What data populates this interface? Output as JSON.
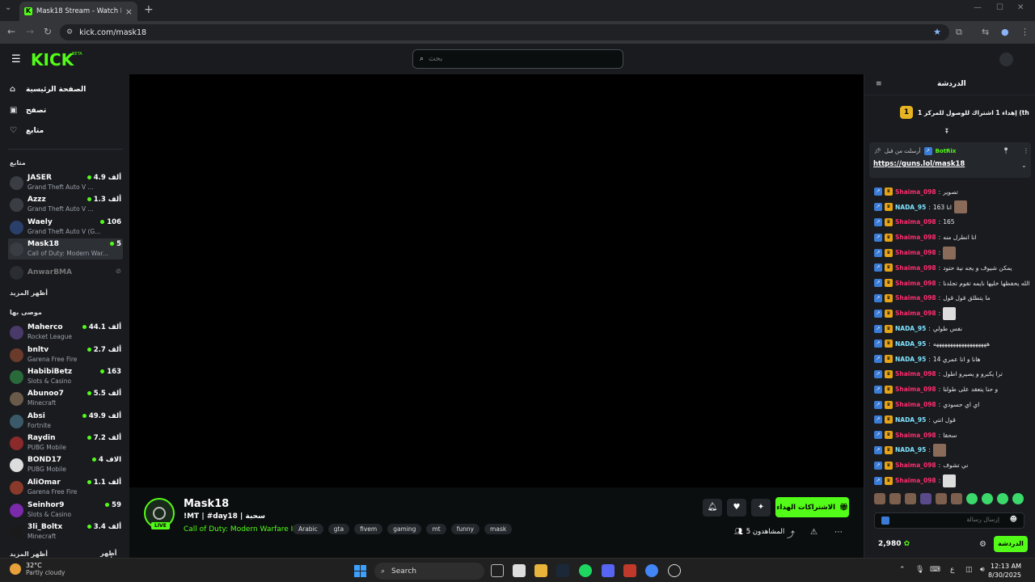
{
  "browser": {
    "tab_title": "Mask18 Stream - Watch Live on",
    "url": "kick.com/mask18"
  },
  "header": {
    "logo": "KICK",
    "logo_badge": "BETA",
    "search_placeholder": "بحث"
  },
  "sidebar": {
    "nav": [
      {
        "label": "الصفحة الرئيسية",
        "icon": "home-icon"
      },
      {
        "label": "تصفح",
        "icon": "browse-icon"
      },
      {
        "label": "متابع",
        "icon": "heart-icon"
      }
    ],
    "following_title": "متابع",
    "following": [
      {
        "name": "JASER",
        "game": "Grand Theft Auto V ...",
        "viewers": "4.9 ألف"
      },
      {
        "name": "Azzz",
        "game": "Grand Theft Auto V ...",
        "viewers": "1.3 ألف"
      },
      {
        "name": "Waely",
        "game": "Grand Theft Auto V (G...",
        "viewers": "106"
      },
      {
        "name": "Mask18",
        "game": "Call of Duty: Modern War...",
        "viewers": "5"
      },
      {
        "name": "AnwarBMA",
        "game": "",
        "viewers": ""
      }
    ],
    "show_more": "أظهر المزيد",
    "recommended_title": "موصى بها",
    "recommended": [
      {
        "name": "Maherco",
        "game": "Rocket League",
        "viewers": "44.1 ألف"
      },
      {
        "name": "bnltv",
        "game": "Garena Free Fire",
        "viewers": "2.7 ألف"
      },
      {
        "name": "HabibiBetz",
        "game": "Slots & Casino",
        "viewers": "163"
      },
      {
        "name": "Abunoo7",
        "game": "Minecraft",
        "viewers": "5.5 ألف"
      },
      {
        "name": "Absi",
        "game": "Fortnite",
        "viewers": "49.9 ألف"
      },
      {
        "name": "Raydin",
        "game": "PUBG Mobile",
        "viewers": "7.2 ألف"
      },
      {
        "name": "BOND17",
        "game": "PUBG Mobile",
        "viewers": "4 الاف"
      },
      {
        "name": "AliOmar",
        "game": "Garena Free Fire",
        "viewers": "1.1 ألف"
      },
      {
        "name": "Seinhor9",
        "game": "Slots & Casino",
        "viewers": "59"
      },
      {
        "name": "3li_Boltx",
        "game": "Minecraft",
        "viewers": "3.4 ألف"
      }
    ],
    "show_more_2": "أظهر المزيد",
    "show_less": "أظهر أقل"
  },
  "stream": {
    "name": "Mask18",
    "title": "!MT | #day18 | سحبة",
    "game": "Call of Duty: Modern Warfare III",
    "live_badge": "LIVE",
    "tags": [
      "Arabic",
      "gta",
      "fivem",
      "gaming",
      "mt",
      "funny",
      "mask"
    ],
    "subscribe_label": "الاشتراكات الهداء",
    "viewers_label": "5 المشاهدون"
  },
  "chat": {
    "title": "الدردشة",
    "goal": "إهداء 1 اشتراك للوصول للمركز 1 (th",
    "goal_rank": "1",
    "pinned_by_label": "أرسلت من قبل",
    "pinned_by": "BotRix",
    "pinned_link": "https://guns.lol/mask18",
    "messages": [
      {
        "user": "Shaima_098",
        "color": "pink",
        "text": "تصوير",
        "emote": ""
      },
      {
        "user": "NADA_95",
        "color": "teal",
        "text": "انا 163",
        "emote": "img"
      },
      {
        "user": "Shaima_098",
        "color": "pink",
        "text": "165",
        "emote": ""
      },
      {
        "user": "Shaima_098",
        "color": "pink",
        "text": "انا انطرل منه",
        "emote": ""
      },
      {
        "user": "Shaima_098",
        "color": "pink",
        "text": "",
        "emote": "img"
      },
      {
        "user": "Shaima_098",
        "color": "pink",
        "text": "يمكن شيوف و يجه نية حتود",
        "emote": ""
      },
      {
        "user": "Shaima_098",
        "color": "pink",
        "text": "الله يحفظها خليها نايمه تقوم تجلدنا",
        "emote": ""
      },
      {
        "user": "Shaima_098",
        "color": "pink",
        "text": "ما يتطلق قول قول",
        "emote": ""
      },
      {
        "user": "Shaima_098",
        "color": "pink",
        "text": "",
        "emote": "white"
      },
      {
        "user": "NADA_95",
        "color": "teal",
        "text": "نفس طولي",
        "emote": ""
      },
      {
        "user": "NADA_95",
        "color": "teal",
        "text": "هههههههههههههههههههه",
        "emote": ""
      },
      {
        "user": "NADA_95",
        "color": "teal",
        "text": "هانا و انا عمري 14",
        "emote": ""
      },
      {
        "user": "Shaima_098",
        "color": "pink",
        "text": "ترا يكبرو و يصيرو اطول",
        "emote": ""
      },
      {
        "user": "Shaima_098",
        "color": "pink",
        "text": "و حنا يتعقد على طولنا",
        "emote": ""
      },
      {
        "user": "Shaima_098",
        "color": "pink",
        "text": "اي اي حسودي",
        "emote": ""
      },
      {
        "user": "NADA_95",
        "color": "teal",
        "text": "قول انتي",
        "emote": ""
      },
      {
        "user": "Shaima_098",
        "color": "pink",
        "text": "سحقا",
        "emote": ""
      },
      {
        "user": "NADA_95",
        "color": "teal",
        "text": "",
        "emote": "img"
      },
      {
        "user": "Shaima_098",
        "color": "pink",
        "text": "ني تشوف",
        "emote": ""
      },
      {
        "user": "Shaima_098",
        "color": "pink",
        "text": "",
        "emote": "white"
      }
    ],
    "input_placeholder": "إرسال رسالة",
    "points": "2,980",
    "send_label": "الدردشة"
  },
  "taskbar": {
    "temp": "32°C",
    "weather": "Partly cloudy",
    "search_label": "Search",
    "time": "12:13 AM",
    "date": "8/30/2025",
    "lang": "ع"
  }
}
